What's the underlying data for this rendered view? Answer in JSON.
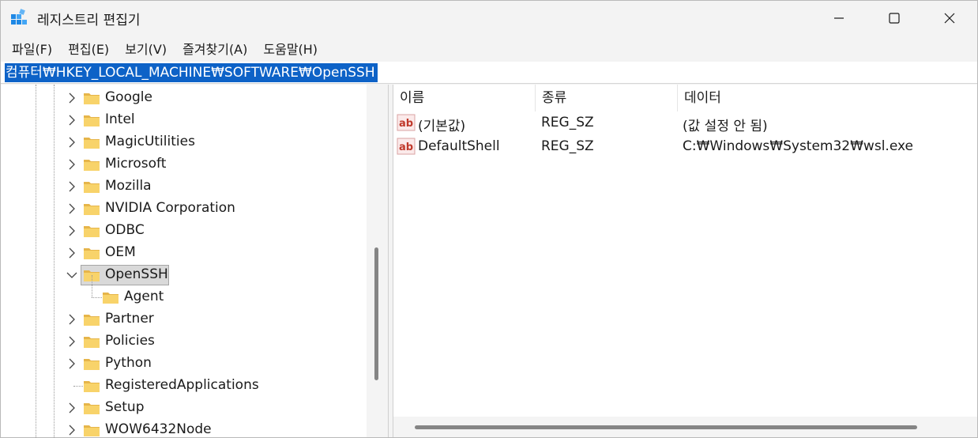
{
  "window": {
    "title": "레지스트리 편집기",
    "icon": "registry-editor-icon"
  },
  "menu": [
    {
      "label": "파일(F)"
    },
    {
      "label": "편집(E)"
    },
    {
      "label": "보기(V)"
    },
    {
      "label": "즐겨찾기(A)"
    },
    {
      "label": "도움말(H)"
    }
  ],
  "address": {
    "path": "컴퓨터₩HKEY_LOCAL_MACHINE₩SOFTWARE₩OpenSSH"
  },
  "tree": {
    "items": [
      {
        "label": "Google",
        "expandable": true,
        "expanded": false,
        "selected": false,
        "level": 0
      },
      {
        "label": "Intel",
        "expandable": true,
        "expanded": false,
        "selected": false,
        "level": 0
      },
      {
        "label": "MagicUtilities",
        "expandable": true,
        "expanded": false,
        "selected": false,
        "level": 0
      },
      {
        "label": "Microsoft",
        "expandable": true,
        "expanded": false,
        "selected": false,
        "level": 0
      },
      {
        "label": "Mozilla",
        "expandable": true,
        "expanded": false,
        "selected": false,
        "level": 0
      },
      {
        "label": "NVIDIA Corporation",
        "expandable": true,
        "expanded": false,
        "selected": false,
        "level": 0
      },
      {
        "label": "ODBC",
        "expandable": true,
        "expanded": false,
        "selected": false,
        "level": 0
      },
      {
        "label": "OEM",
        "expandable": true,
        "expanded": false,
        "selected": false,
        "level": 0
      },
      {
        "label": "OpenSSH",
        "expandable": true,
        "expanded": true,
        "selected": true,
        "level": 0
      },
      {
        "label": "Agent",
        "expandable": false,
        "expanded": false,
        "selected": false,
        "level": 1
      },
      {
        "label": "Partner",
        "expandable": true,
        "expanded": false,
        "selected": false,
        "level": 0
      },
      {
        "label": "Policies",
        "expandable": true,
        "expanded": false,
        "selected": false,
        "level": 0
      },
      {
        "label": "Python",
        "expandable": true,
        "expanded": false,
        "selected": false,
        "level": 0
      },
      {
        "label": "RegisteredApplications",
        "expandable": false,
        "expanded": false,
        "selected": false,
        "level": 0
      },
      {
        "label": "Setup",
        "expandable": true,
        "expanded": false,
        "selected": false,
        "level": 0
      },
      {
        "label": "WOW6432Node",
        "expandable": true,
        "expanded": false,
        "selected": false,
        "level": 0
      }
    ]
  },
  "list": {
    "columns": [
      {
        "label": "이름"
      },
      {
        "label": "종류"
      },
      {
        "label": "데이터"
      }
    ],
    "rows": [
      {
        "name": "(기본값)",
        "type": "REG_SZ",
        "data": "(값 설정 안 됨)",
        "icon": "string-value-icon"
      },
      {
        "name": "DefaultShell",
        "type": "REG_SZ",
        "data": "C:₩Windows₩System32₩wsl.exe",
        "icon": "string-value-icon"
      }
    ]
  },
  "colors": {
    "selection_blue": "#0d62c7",
    "folder_yellow": "#f8d36a",
    "folder_yellow_dark": "#e6b54a",
    "ab_icon_red": "#c0392b"
  }
}
